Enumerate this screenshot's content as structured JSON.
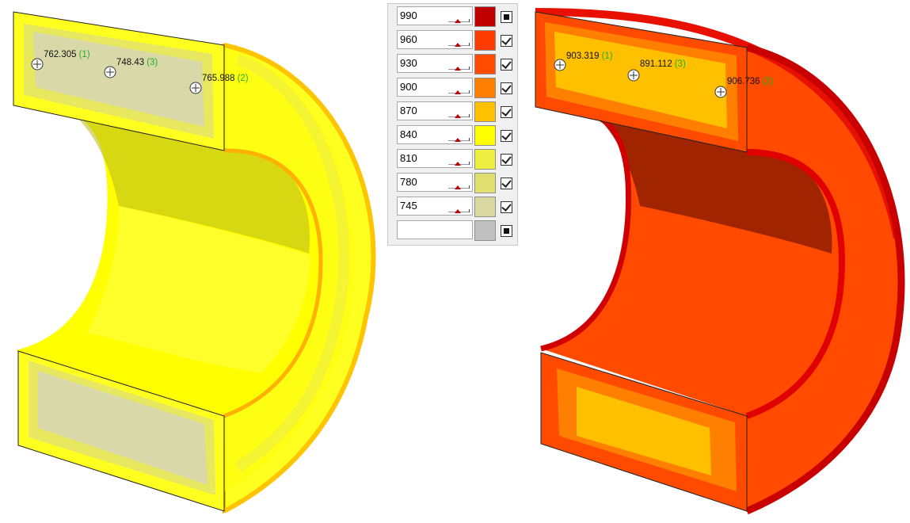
{
  "left_view": {
    "probes": [
      {
        "value": "762.305",
        "id": "(1)"
      },
      {
        "value": "748.43",
        "id": "(3)"
      },
      {
        "value": "765.988",
        "id": "(2)"
      }
    ]
  },
  "right_view": {
    "probes": [
      {
        "value": "903.319",
        "id": "(1)"
      },
      {
        "value": "891.112",
        "id": "(3)"
      },
      {
        "value": "906.736",
        "id": "(2)"
      }
    ]
  },
  "legend": {
    "rows": [
      {
        "value": "990",
        "color": "#c00000",
        "toggle": "filled"
      },
      {
        "value": "960",
        "color": "#ff3c00",
        "toggle": "checked"
      },
      {
        "value": "930",
        "color": "#ff4a00",
        "toggle": "checked"
      },
      {
        "value": "900",
        "color": "#ff8000",
        "toggle": "checked"
      },
      {
        "value": "870",
        "color": "#ffc000",
        "toggle": "checked"
      },
      {
        "value": "840",
        "color": "#ffff00",
        "toggle": "checked"
      },
      {
        "value": "810",
        "color": "#eeee40",
        "toggle": "checked"
      },
      {
        "value": "780",
        "color": "#e0e070",
        "toggle": "checked"
      },
      {
        "value": "745",
        "color": "#d8d8a0",
        "toggle": "checked"
      },
      {
        "value": "",
        "color": "#c0c0c0",
        "toggle": "filled"
      }
    ]
  }
}
